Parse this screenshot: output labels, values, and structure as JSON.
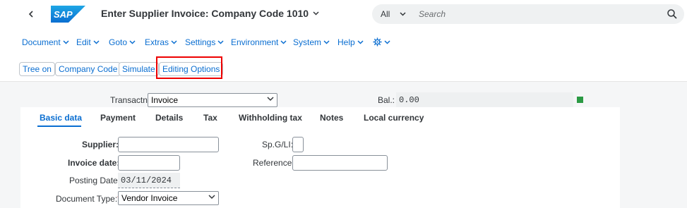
{
  "shell": {
    "back_icon": "chevron-left-icon",
    "logo_text": "SAP",
    "title": "Enter Supplier Invoice: Company Code 1010",
    "search_scope": "All",
    "search_placeholder": "Search",
    "search_icon": "search-icon"
  },
  "menu": {
    "items": [
      "Document",
      "Edit",
      "Goto",
      "Extras",
      "Settings",
      "Environment",
      "System",
      "Help"
    ],
    "gear_icon": "gear-icon"
  },
  "toolbar": {
    "buttons": [
      "Tree on",
      "Company Code",
      "Simulate",
      "Editing Options"
    ]
  },
  "header": {
    "transaction_label": "Transactn:",
    "transaction_value": "Invoice",
    "balance_label": "Bal.:",
    "balance_value": "0.00",
    "status_color": "#2b9a44"
  },
  "tabs": [
    "Basic data",
    "Payment",
    "Details",
    "Tax",
    "Withholding tax",
    "Notes",
    "Local currency"
  ],
  "form": {
    "supplier_label": "Supplier:",
    "supplier_value": "",
    "invoice_date_label": "Invoice date:",
    "invoice_date_value": "",
    "posting_date_label": "Posting Date:",
    "posting_date_value": "03/11/2024",
    "document_type_label": "Document Type:",
    "document_type_required": "*",
    "document_type_value": "Vendor Invoice",
    "spgl_label": "Sp.G/LI:",
    "spgl_value": "",
    "reference_label": "Reference:",
    "reference_value": ""
  },
  "colors": {
    "accent": "#0a6ed1",
    "highlight": "#ee0000",
    "required": "#bb0000"
  }
}
